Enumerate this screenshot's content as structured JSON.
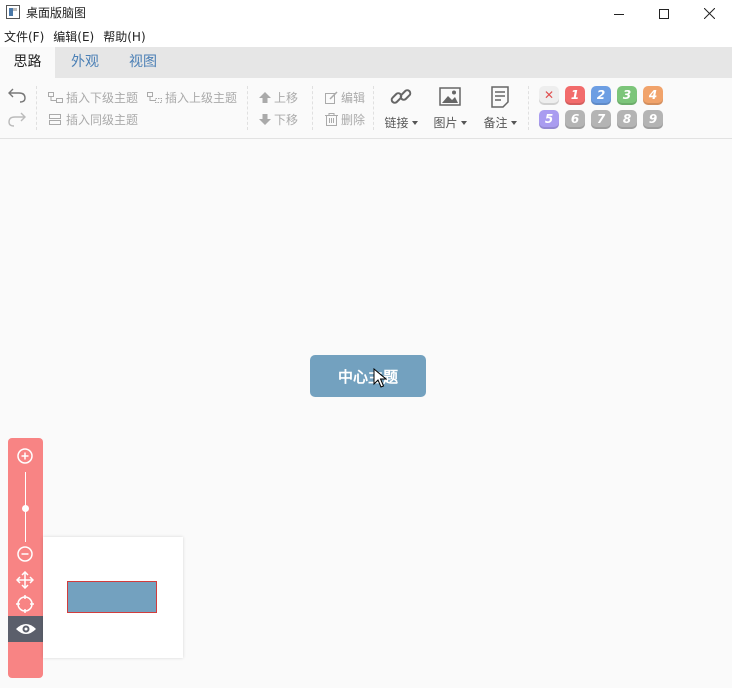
{
  "window": {
    "title": "桌面版脑图",
    "minimize_icon": "minimize-icon",
    "maximize_icon": "maximize-icon",
    "close_icon": "close-icon"
  },
  "menu": [
    {
      "label": "文件(F)"
    },
    {
      "label": "编辑(E)"
    },
    {
      "label": "帮助(H)"
    }
  ],
  "tabs": [
    {
      "label": "思路",
      "active": true
    },
    {
      "label": "外观",
      "active": false
    },
    {
      "label": "视图",
      "active": false
    }
  ],
  "toolbar": {
    "undo_icon": "undo-icon",
    "redo_icon": "redo-icon",
    "insert_child": "插入下级主题",
    "insert_parent": "插入上级主题",
    "insert_sibling": "插入同级主题",
    "move_up": "上移",
    "move_down": "下移",
    "edit": "编辑",
    "delete": "删除",
    "link": "链接",
    "image": "图片",
    "note": "备注",
    "priorities": [
      "✕",
      "1",
      "2",
      "3",
      "4",
      "5",
      "6",
      "7",
      "8",
      "9"
    ],
    "priority_colors": [
      "#eeeeee",
      "#f26b6b",
      "#6d9ee3",
      "#7cc57a",
      "#f1a36b",
      "#a99cf0",
      "#b4b4b4",
      "#b4b4b4",
      "#b4b4b4",
      "#b4b4b4"
    ]
  },
  "canvas": {
    "center_topic": "中心主题",
    "node_color": "#73a1bf"
  },
  "zoom_panel": {
    "color": "#f88484",
    "zoom_in_icon": "zoom-in-icon",
    "zoom_out_icon": "zoom-out-icon",
    "move_icon": "move-icon",
    "locate_icon": "locate-icon",
    "eye_icon": "eye-icon"
  }
}
